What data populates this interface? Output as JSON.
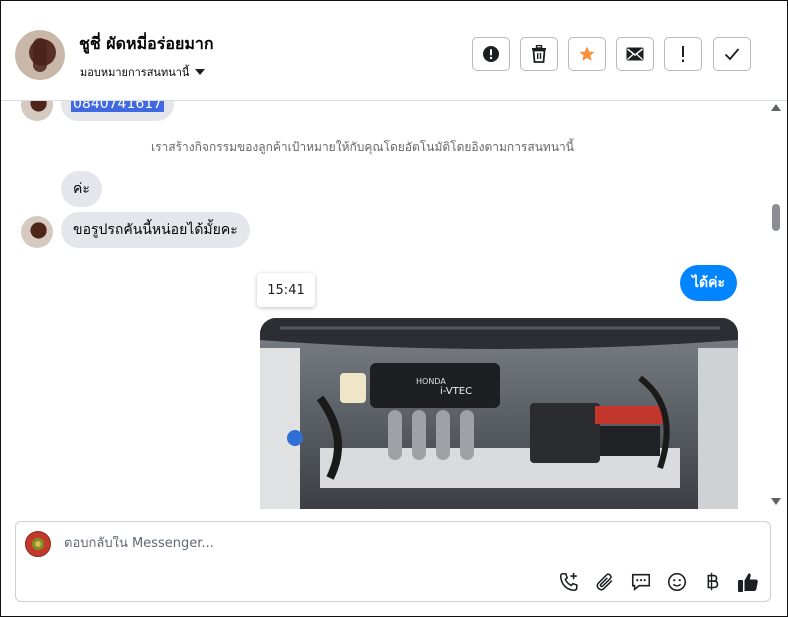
{
  "header": {
    "contact_name": "ชูชี่ ผัดหมี่อร่อยมาก",
    "assign_label": "มอบหมายการสนทนานี้",
    "buttons": [
      "spam-alert",
      "delete",
      "star",
      "mark-unread",
      "follow-up",
      "done"
    ]
  },
  "thread": {
    "phone_fragment": "0840741617",
    "system_message": "เราสร้างกิจกรรมของลูกค้าเป้าหมายให้กับคุณโดยอัตโนมัติโดยอิงตามการสนทนานี้",
    "incoming": [
      {
        "text": "ค่ะ"
      },
      {
        "text": "ขอรูปรถคันนี้หน่อยได้มั้ยคะ"
      }
    ],
    "outgoing": [
      {
        "text": "ได้ค่ะ"
      }
    ],
    "timestamp": "15:41",
    "photo_text": {
      "engine_brand": "HONDA",
      "engine_badge": "i-VTEC"
    }
  },
  "composer": {
    "placeholder": "ตอบกลับใน Messenger...",
    "icons": [
      "call-add-icon",
      "attachment-icon",
      "saved-replies-icon",
      "emoji-icon",
      "baht-icon",
      "like-icon"
    ]
  },
  "colors": {
    "accent_blue": "#0084ff",
    "star_orange": "#f7923a",
    "bubble_gray": "#e4e6eb",
    "selection_blue": "#4169e1"
  }
}
